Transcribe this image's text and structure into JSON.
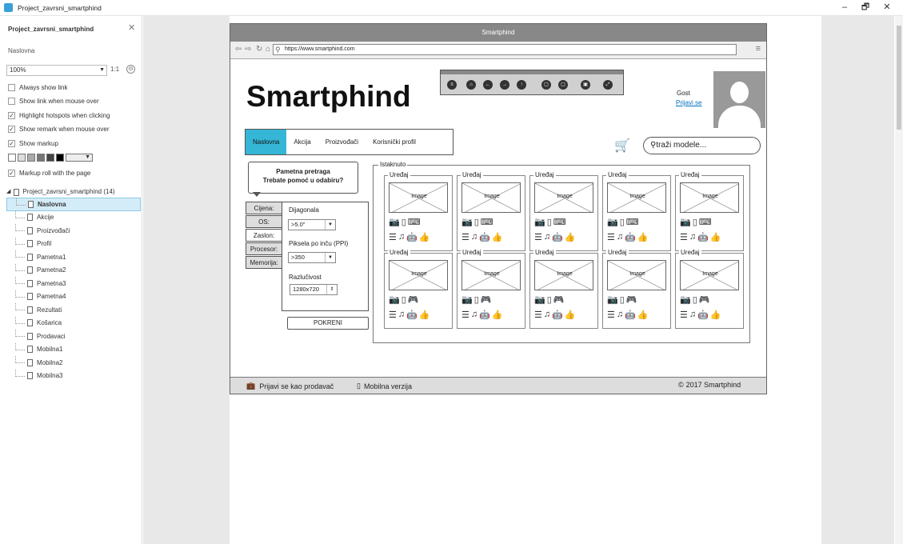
{
  "window": {
    "title": "Project_zavrsni_smartphind",
    "minimize": "–",
    "restore": "🗗",
    "close": "✕"
  },
  "sidebar": {
    "project": "Project_zavrsni_smartphind",
    "close": "✕",
    "current_page": "Naslovna",
    "zoom": "100%",
    "ratio": "1:1",
    "options": [
      {
        "label": "Always show link",
        "checked": false
      },
      {
        "label": "Show link when mouse over",
        "checked": false
      },
      {
        "label": "Highlight hotspots when clicking",
        "checked": true
      },
      {
        "label": "Show remark when mouse over",
        "checked": true
      },
      {
        "label": "Show markup",
        "checked": true
      },
      {
        "label": "Markup roll with the page",
        "checked": true
      }
    ],
    "tree_root": "Project_zavrsni_smartphind (14)",
    "pages": [
      "Naslovna",
      "Akcije",
      "Proizvođači",
      "Profil",
      "Pametna1",
      "Pametna2",
      "Pametna3",
      "Pametna4",
      "Rezultati",
      "Košarica",
      "Prodavaci",
      "Mobilna1",
      "Mobilna2",
      "Mobilna3"
    ]
  },
  "browser": {
    "title": "Smartphind",
    "url": "https://www.smartphind.com",
    "logo": "Smartphind",
    "guest": "Gost",
    "login": "Prijavi se",
    "tabs": [
      "Naslovna",
      "Akcija",
      "Proizvođači",
      "Korisnički profil"
    ],
    "search_placeholder": "traži modele...",
    "bubble_line1": "Pametna pretraga",
    "bubble_line2": "Trebate pomoć u odabiru?",
    "filter_tabs": [
      "Cijena:",
      "OS:",
      "Zaslon:",
      "Procesor:",
      "Memorija:"
    ],
    "filters": {
      "diag_label": "Dijagonala",
      "diag_value": ">5.0\"",
      "ppi_label": "Piksela po inču (PPI)",
      "ppi_value": ">350",
      "res_label": "Razlučivost",
      "res_value": "1280x720"
    },
    "run_button": "POKRENI",
    "featured_label": "Istaknuto",
    "card_label": "Uređaj",
    "image_label": "Image",
    "footer": {
      "seller": "Prijavi se kao prodavač",
      "mobile": "Mobilna verzija",
      "copyright": "2017 Smartphind"
    }
  }
}
